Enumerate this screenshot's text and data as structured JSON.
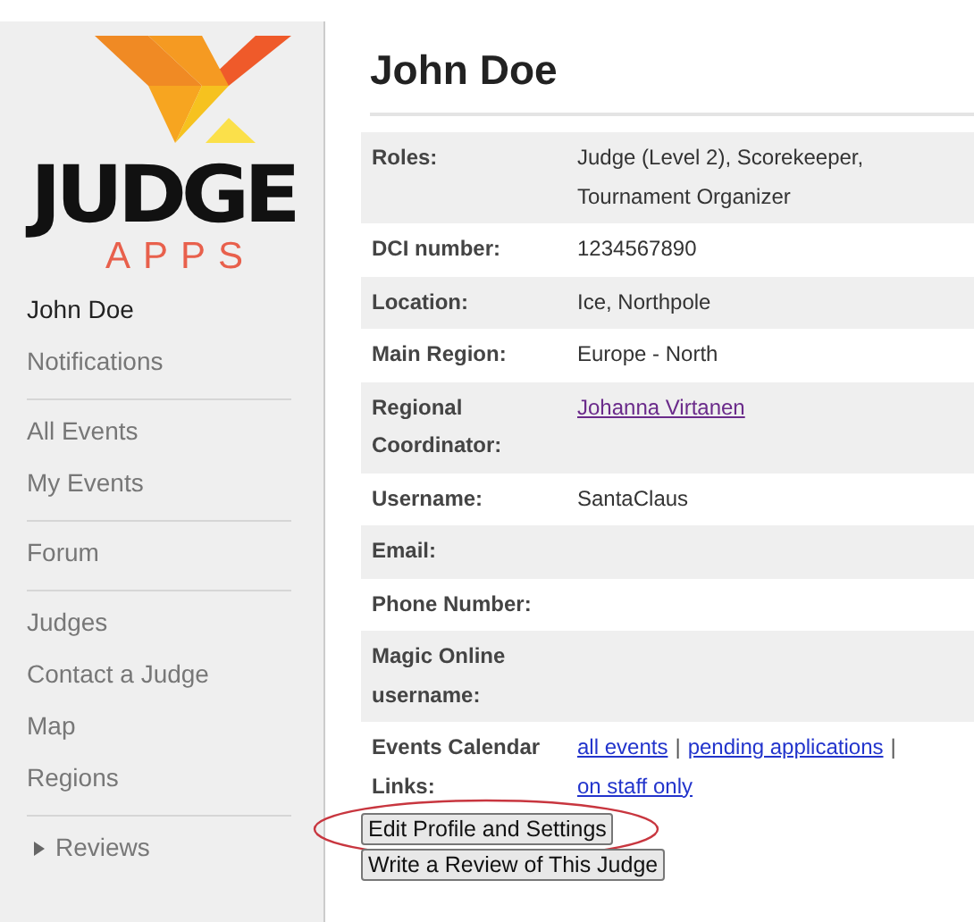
{
  "logo": {
    "word": "JUDGE",
    "sub": "APPS"
  },
  "sidebar": {
    "groups": [
      [
        {
          "label": "John Doe",
          "current": true
        },
        {
          "label": "Notifications",
          "current": false
        }
      ],
      [
        {
          "label": "All Events",
          "current": false
        },
        {
          "label": "My Events",
          "current": false
        }
      ],
      [
        {
          "label": "Forum",
          "current": false
        }
      ],
      [
        {
          "label": "Judges",
          "current": false
        },
        {
          "label": "Contact a Judge",
          "current": false
        },
        {
          "label": "Map",
          "current": false
        },
        {
          "label": "Regions",
          "current": false
        }
      ],
      [
        {
          "label": "Reviews",
          "current": false,
          "expanded": false
        }
      ]
    ]
  },
  "profile": {
    "name": "John Doe",
    "rows": [
      {
        "label": "Roles:",
        "kind": "text",
        "value": "Judge (Level 2), Scorekeeper, Tournament Organizer"
      },
      {
        "label": "DCI number:",
        "kind": "text",
        "value": "1234567890"
      },
      {
        "label": "Location:",
        "kind": "text",
        "value": "Ice, Northpole"
      },
      {
        "label": "Main Region:",
        "kind": "text",
        "value": "Europe - North"
      },
      {
        "label": "Regional Coordinator:",
        "kind": "link",
        "value": "Johanna Virtanen",
        "visited": true
      },
      {
        "label": "Username:",
        "kind": "text",
        "value": "SantaClaus"
      },
      {
        "label": "Email:",
        "kind": "text"
      },
      {
        "label": "Phone Number:",
        "kind": "text"
      },
      {
        "label": "Magic Online username:",
        "kind": "text"
      },
      {
        "label": "Events Calendar Links:",
        "kind": "links",
        "links": [
          {
            "text": "all events",
            "visited": false
          },
          {
            "text": "pending applications",
            "visited": false
          },
          {
            "text": "on staff only",
            "visited": false
          }
        ],
        "separator": "|"
      }
    ],
    "buttons": [
      {
        "label": "Edit Profile and Settings",
        "circled": true
      },
      {
        "label": "Write a Review of This Judge",
        "circled": false
      }
    ]
  }
}
